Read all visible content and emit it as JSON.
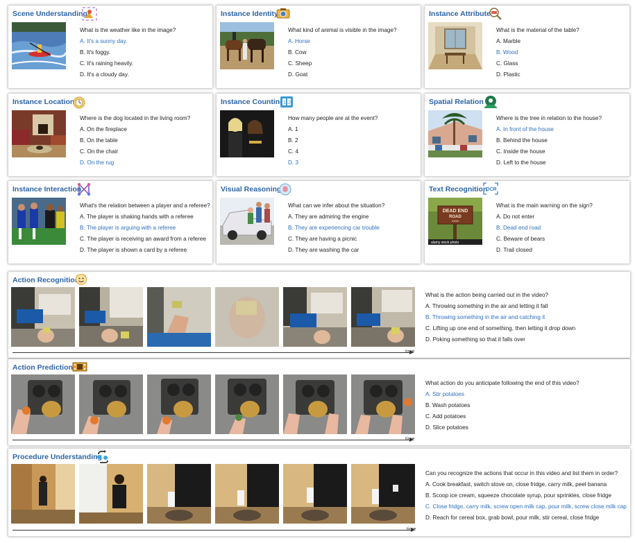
{
  "cards": [
    {
      "title": "Scene Understanding",
      "icon": "scene-icon",
      "question": "What is the weather like in the image?",
      "options": [
        "A. It's a sunny day.",
        "B. It's foggy.",
        "C. It's raining heavily.",
        "D. It's a cloudy day."
      ],
      "correct": 0
    },
    {
      "title": "Instance Identity",
      "icon": "camera-icon",
      "question": "What kind of animal is visible in the image?",
      "options": [
        "A. Horse",
        "B. Cow",
        "C. Sheep",
        "D. Goat"
      ],
      "correct": 0
    },
    {
      "title": "Instance Attribute",
      "icon": "magnifier-tag-icon",
      "question": "What is the material of the table?",
      "options": [
        "A. Marble",
        "B. Wood",
        "C. Glass",
        "D. Plastic"
      ],
      "correct": 1
    },
    {
      "title": "Instance Location",
      "icon": "location-clock-icon",
      "question": "Where is the dog located in the living room?",
      "options": [
        "A. On the fireplace",
        "B. On the table",
        "C. On the chair",
        "D. On the rug"
      ],
      "correct": 3
    },
    {
      "title": "Instance Counting",
      "icon": "counter-icon",
      "question": "How many people are at the event?",
      "options": [
        "A. 1",
        "B. 2",
        "C. 4",
        "D. 3"
      ],
      "correct": 3
    },
    {
      "title": "Spatial Relation",
      "icon": "people-pin-icon",
      "question": "Where is the tree in relation to the house?",
      "options": [
        "A. In front of the house",
        "B. Behind the house",
        "C. Inside the house",
        "D. Left to the house"
      ],
      "correct": 0
    },
    {
      "title": "Instance Interaction",
      "icon": "network-icon",
      "question": "What's the relation between a player and a referee?",
      "options": [
        "A. The player is shaking hands with a referee",
        "B. The player is arguing with a referee",
        "C. The player is receiving an award from a referee",
        "D. The player is shown a card by a referee"
      ],
      "correct": 1
    },
    {
      "title": "Visual Reasoning",
      "icon": "brain-icon",
      "question": "What can we infer about the situation?",
      "options": [
        "A. They are admiring the engine",
        "B. They are experiencing car trouble",
        "C. They are having a picnic",
        "D. They are washing the car"
      ],
      "correct": 1
    },
    {
      "title": "Text Recognition",
      "icon": "ocr-icon",
      "question": "What is the main warning on the sign?",
      "options": [
        "A. Do not enter",
        "B. Dead end road",
        "C. Beware of bears",
        "D. Trail closed"
      ],
      "correct": 1
    }
  ],
  "sign_text": {
    "line1": "DEAD END",
    "line2": "ROAD",
    "line3": "SIGN",
    "watermark": "alamy stock photo"
  },
  "videos": [
    {
      "title": "Action Recognition",
      "icon": "action-icon",
      "question": "What is the action being carried out in the video?",
      "options": [
        "A. Throwing something in the air and letting it fall",
        "B. Throwing something in the air and catching it",
        "C. Lifting up one end of something, then letting it drop down",
        "D. Poking something so that it falls over"
      ],
      "correct": 1,
      "time_label": "time"
    },
    {
      "title": "Action Prediction",
      "icon": "film-icon",
      "question": "What action do you anticipate following the end of this video?",
      "options": [
        "A. Stir potatoes",
        "B. Wash potatoes",
        "C. Add potatoes",
        "D. Slice potatoes"
      ],
      "correct": 0,
      "time_label": "time"
    },
    {
      "title": "Procedure Understanding",
      "icon": "procedure-icon",
      "question": "Can you recognize the actions that occur in this video and list them in order?",
      "options": [
        "A. Cook breakfast, switch stove on, close fridge, carry milk, peel banana",
        "B. Scoop ice cream, squeeze chocolate syrup, pour sprinkles, close fridge",
        "C. Close fridge, carry milk, screw open milk cap, pour milk, screw close milk cap",
        "D. Reach for cereal box, grab bowl, pour milk, stir cereal, close fridge"
      ],
      "correct": 2,
      "time_label": "time"
    }
  ],
  "colors": {
    "title": "#2e64a8",
    "correct": "#2e6fbd",
    "text": "#222222"
  }
}
